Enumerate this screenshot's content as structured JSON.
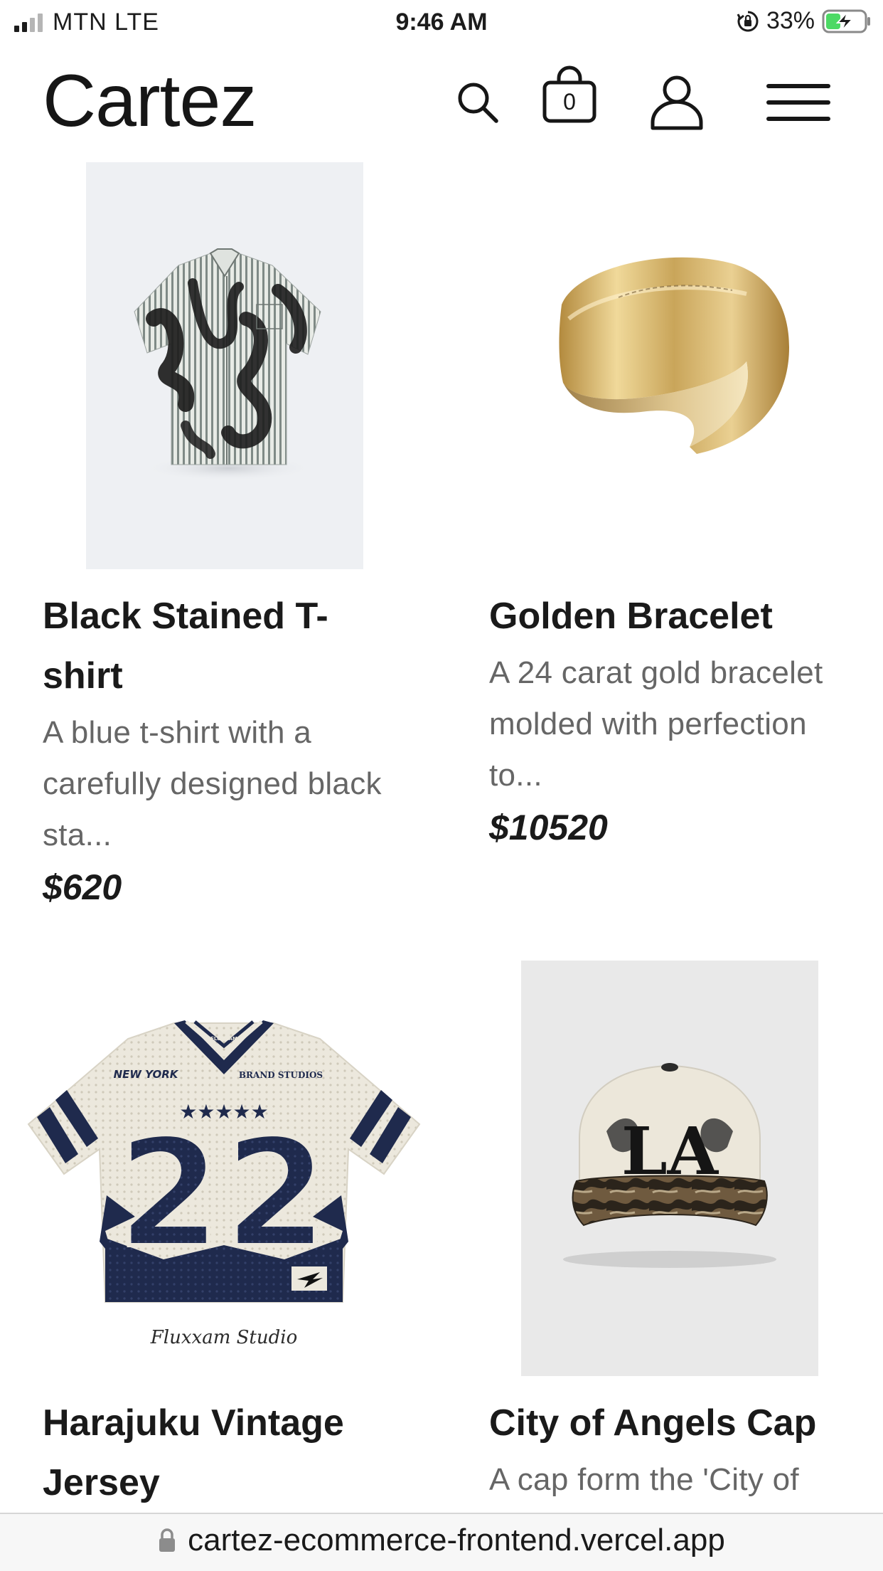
{
  "status_bar": {
    "carrier": "MTN  LTE",
    "time": "9:46 AM",
    "battery_percent": "33%",
    "signal_bars_active": 2,
    "signal_bars_total": 4,
    "battery_level": 0.33,
    "charging": true
  },
  "header": {
    "brand": "Cartez",
    "cart_count": "0",
    "icons": [
      "search-icon",
      "shopping-bag-icon",
      "user-icon",
      "hamburger-menu-icon"
    ]
  },
  "products": [
    {
      "title": "Black Stained T-shirt",
      "title_lines": [
        "Black Stained T-",
        "shirt"
      ],
      "description_lines": [
        "A blue t-shirt with a",
        "carefully designed black",
        "sta..."
      ],
      "price": "$620",
      "image": "striped-shirt-with-black-stains"
    },
    {
      "title": "Golden Bracelet",
      "title_lines": [
        "Golden Bracelet"
      ],
      "description_lines": [
        "A 24 carat gold bracelet",
        "molded with perfection",
        "to..."
      ],
      "price": "$10520",
      "image": "gold-cuff-bracelet"
    },
    {
      "title": "Harajuku Vintage Jersey",
      "title_lines": [
        "Harajuku Vintage",
        "Jersey"
      ],
      "description_lines": [],
      "price": "",
      "image": "vintage-number-22-jersey",
      "image_text": {
        "number": "22",
        "left_chest": "NEW YORK",
        "right_chest": "BRAND STUDIOS",
        "collar": "FLUXXAM",
        "caption": "Fluxxam Studio"
      }
    },
    {
      "title": "City of Angels Cap",
      "title_lines": [
        "City of Angels Cap"
      ],
      "description_lines": [
        "A cap form the 'City of"
      ],
      "price": "",
      "image": "la-camo-cap",
      "image_text": {
        "logo": "LA"
      }
    }
  ],
  "url_bar": {
    "url": "cartez-ecommerce-frontend.vercel.app"
  },
  "colors": {
    "text": "#1a1a1a",
    "muted_text": "#666666",
    "image_bg": "#eef0f3",
    "cap_bg": "#e9e9e9",
    "jersey_navy": "#1f2a4d",
    "jersey_cream": "#ece8dd",
    "gold": "#d4b46a"
  }
}
